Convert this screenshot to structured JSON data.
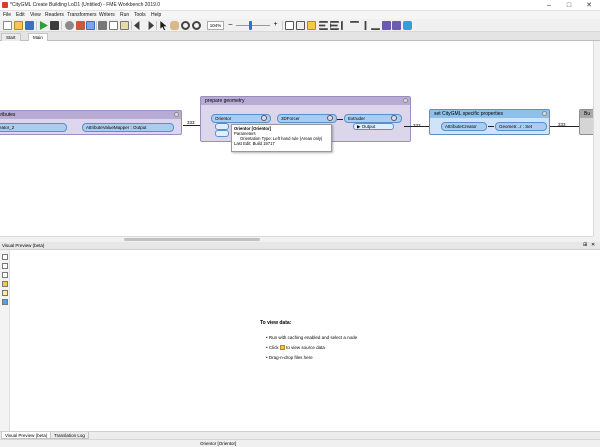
{
  "window": {
    "title": "*CityGML Create Building LoD1 (Untitled) - FME Workbench 2019.0",
    "minimize_glyph": "–",
    "maximize_glyph": "□",
    "close_glyph": "✕"
  },
  "menu": [
    "File",
    "Edit",
    "View",
    "Readers",
    "Transformers",
    "Writers",
    "Run",
    "Tools",
    "Help"
  ],
  "toolbar": {
    "zoom_value": "104%",
    "zoom_minus": "–",
    "zoom_plus": "+"
  },
  "doc_tabs": [
    "Start",
    "Main"
  ],
  "canvas": {
    "bookmark_left": {
      "title": "tributes",
      "xf_partial": "eator_2",
      "xf_mapper": "AttributeValueMapper",
      "xf_mapper_port": "Output",
      "count": "333"
    },
    "bookmark_geometry": {
      "title": "prepare geometry",
      "orientor": "Orientor",
      "threedforcer": "3DForcer",
      "extruder": "Extruder",
      "extruder_port": "Output",
      "count_in": "333",
      "count_out": "333"
    },
    "bookmark_citygml": {
      "title": "set CityGML specific properties",
      "attribute_creator": "AttributeCreator",
      "geometry_setter": "Geometr...r : Set",
      "count_out": "333"
    },
    "bookmark_right_partial": {
      "title": "Bu"
    }
  },
  "tooltip": {
    "title": "Orientor [Orientor]",
    "section": "Parameters",
    "orientation": "Orientation Type: Left hand rule (Areas only)",
    "last_edit": "Last Edit: Build 19717"
  },
  "preview": {
    "panel_title": "Visual Preview (beta)",
    "pin_glyph": "⊞",
    "close_glyph": "✕",
    "hint_title": "To view data:",
    "hints": [
      "Run with caching enabled and select a node",
      "Click",
      "to view source data",
      "Drag-n-drop files here"
    ]
  },
  "bottom_tabs": [
    "Visual Preview (beta)",
    "Translation Log"
  ],
  "status": "Orientor [Orientor]",
  "colors": {
    "geometry_bookmark": "#dcd6ea",
    "geometry_header": "#b8acd4",
    "citygml_bookmark": "#cfe4f8",
    "citygml_header": "#8ec0ea",
    "left_bookmark": "#ddd6ee",
    "transformer": "#a9cdf2",
    "accent": "#2c6fd6"
  }
}
